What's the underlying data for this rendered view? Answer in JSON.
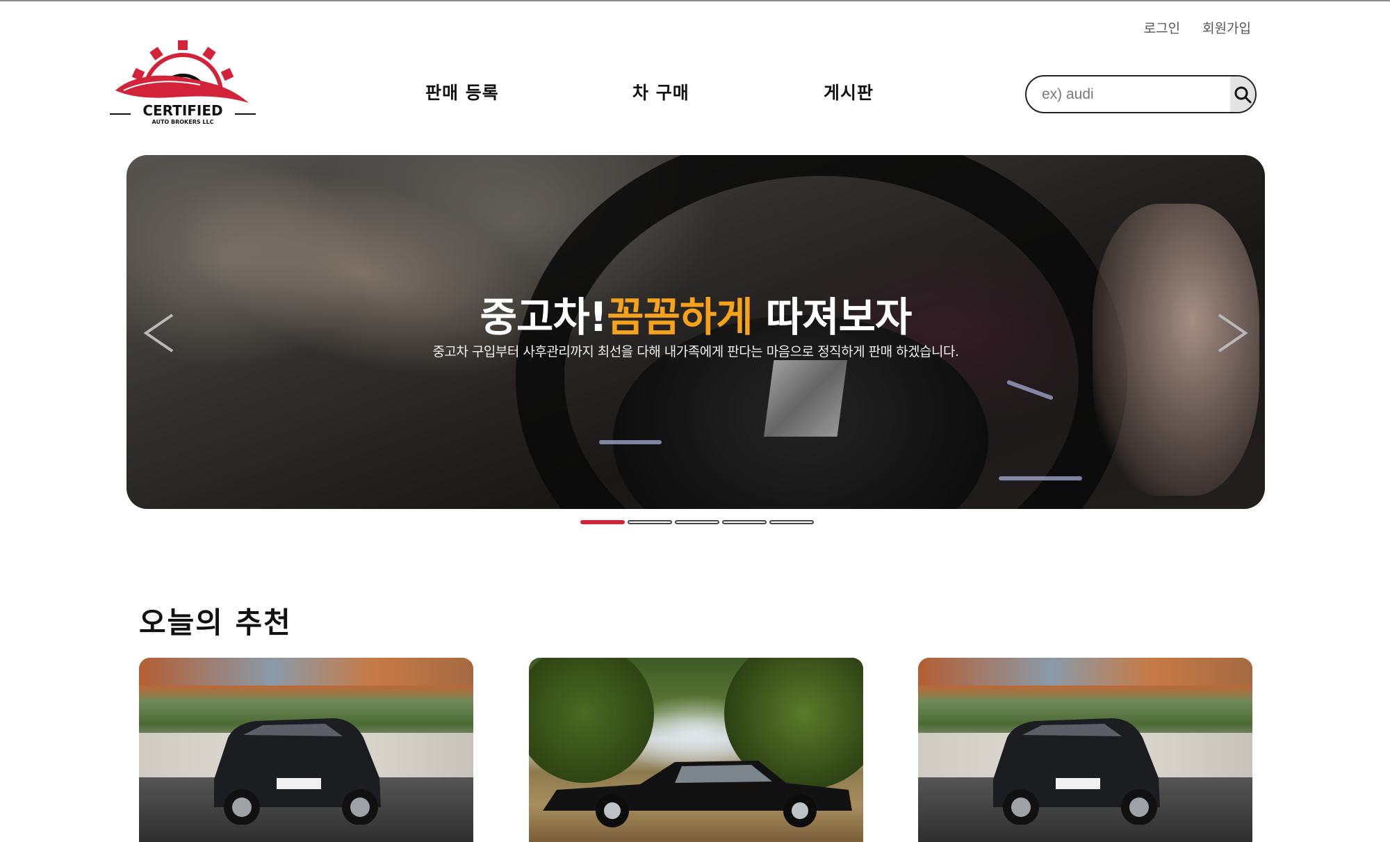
{
  "header": {
    "login": "로그인",
    "signup": "회원가입",
    "logo_text": "CERTIFIED",
    "logo_sub": "AUTO BROKERS LLC",
    "nav": [
      "판매 등록",
      "차 구매",
      "게시판"
    ],
    "search_placeholder": "ex) audi"
  },
  "hero": {
    "headline_part1": "중고차!",
    "headline_highlight": "꼼꼼하게",
    "headline_part2": " 따져보자",
    "subline": "중고차 구입부터 사후관리까지 최선을 다해 내가족에게 판다는 마음으로 정직하게 판매 하겠습니다.",
    "slides_total": 5,
    "active_slide": 1,
    "colors": {
      "highlight": "#f6a21b",
      "indicator_active": "#d2233a"
    }
  },
  "section": {
    "title": "오늘의 추천"
  },
  "cards": [
    {
      "photo": "black-suv-kona"
    },
    {
      "photo": "black-classic-sedan"
    },
    {
      "photo": "black-suv-kona"
    }
  ]
}
